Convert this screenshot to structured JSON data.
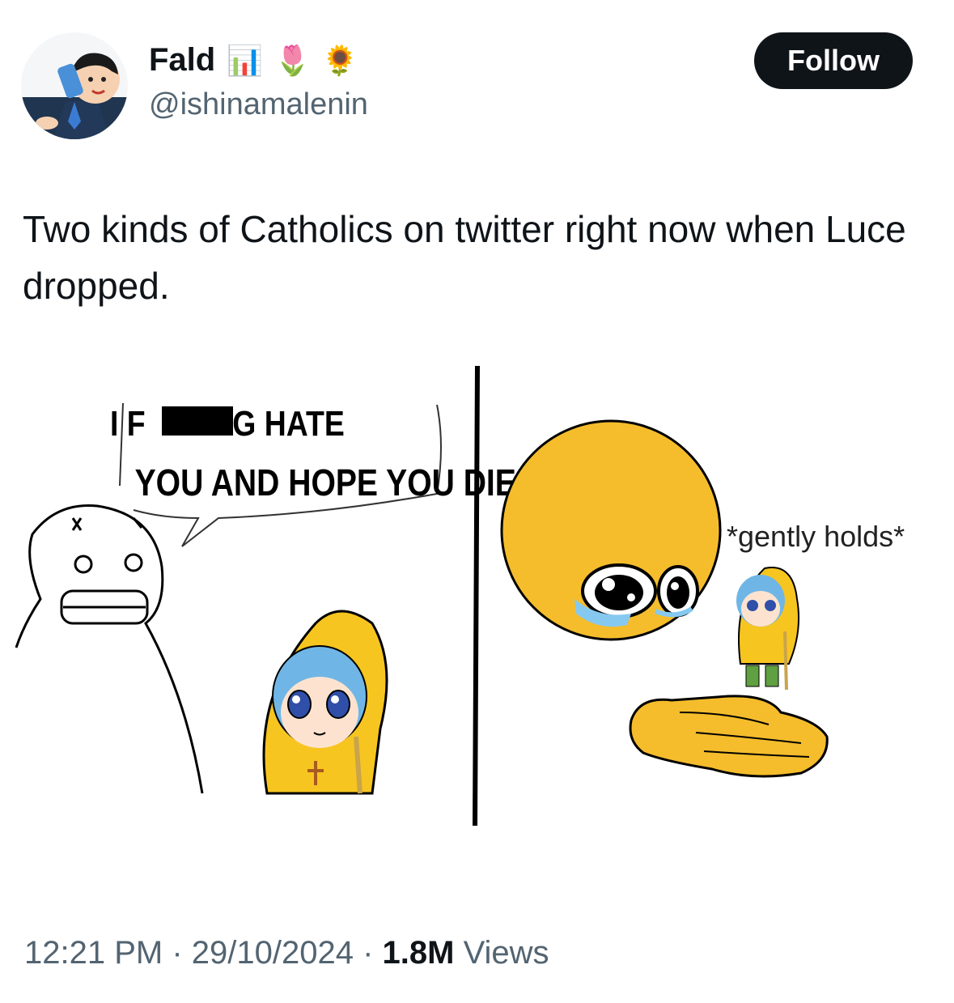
{
  "author": {
    "display_name": "Fald",
    "badges": [
      "📊",
      "🌷",
      "🌻"
    ],
    "handle": "@ishinamalenin",
    "avatar_icon": "man-on-phone-avatar-icon"
  },
  "follow_button": {
    "label": "Follow"
  },
  "tweet": {
    "text": "Two kinds of Catholics on twitter right now when Luce dropped."
  },
  "meme": {
    "left_bubble_line1_a": "I F",
    "left_bubble_line1_b": "G HATE",
    "left_bubble_line2": "YOU AND HOPE YOU DIE",
    "right_caption": "*gently holds*",
    "colors": {
      "emoji_yellow": "#f5bd2c",
      "raincoat_yellow": "#f7c520",
      "hair_blue": "#6fb6e6"
    }
  },
  "meta": {
    "time": "12:21 PM",
    "sep1": " · ",
    "date": "29/10/2024",
    "sep2": " · ",
    "views_count": "1.8M",
    "views_label": " Views"
  }
}
